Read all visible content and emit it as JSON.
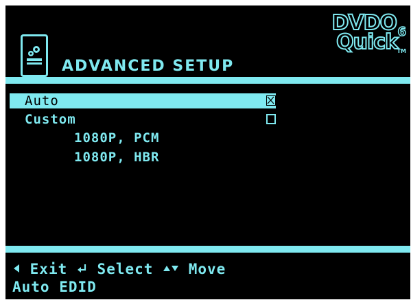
{
  "header": {
    "title": "ADVANCED SETUP",
    "logo_line1": "DVDO",
    "logo_line2": "Quick",
    "logo_super": "6",
    "logo_tm": "TM",
    "icon": "setup-gear-icon"
  },
  "menu": {
    "items": [
      {
        "label": "Auto",
        "checked": true,
        "selected": true
      },
      {
        "label": "Custom",
        "checked": false,
        "selected": false
      }
    ],
    "custom_options": [
      "1080P, PCM",
      "1080P, HBR"
    ]
  },
  "footer": {
    "exit_label": "Exit",
    "select_label": "Select",
    "move_label": "Move",
    "status": "Auto EDID"
  },
  "colors": {
    "accent": "#7fe9f0",
    "background": "#000000"
  }
}
